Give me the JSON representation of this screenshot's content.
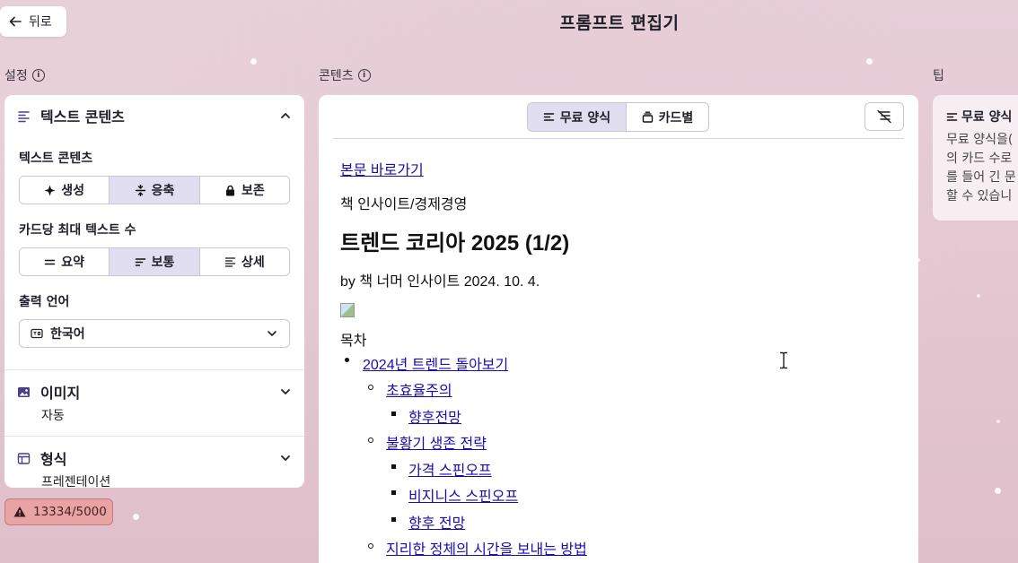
{
  "header": {
    "back_label": "뒤로",
    "title": "프롬프트 편집기"
  },
  "sections": {
    "settings": "설정",
    "content": "콘텐츠",
    "tips": "팁"
  },
  "settings": {
    "text_content": {
      "title": "텍스트 콘텐츠",
      "mode_label": "텍스트 콘텐츠",
      "modes": [
        {
          "label": "생성",
          "icon": "sparkle-icon"
        },
        {
          "label": "응축",
          "icon": "condense-icon"
        },
        {
          "label": "보존",
          "icon": "lock-icon"
        }
      ],
      "active_mode": "응축",
      "amount_label": "카드당 최대 텍스트 수",
      "amounts": [
        {
          "label": "요약",
          "icon": "short-text-icon"
        },
        {
          "label": "보통",
          "icon": "medium-text-icon"
        },
        {
          "label": "상세",
          "icon": "long-text-icon"
        }
      ],
      "active_amount": "보통",
      "language_label": "출력 언어",
      "language_value": "한국어"
    },
    "image": {
      "title": "이미지",
      "value": "자동"
    },
    "format": {
      "title": "형식",
      "value": "프레젠테이션"
    }
  },
  "credit_warning": "13334/5000",
  "content": {
    "toggle": [
      {
        "label": "무료 양식",
        "icon": "freeform-icon"
      },
      {
        "label": "카드별",
        "icon": "cards-icon"
      }
    ],
    "active_toggle": "무료 양식",
    "doc": {
      "skip_link": "본문 바로가기",
      "breadcrumb": "책 인사이트/경제경영",
      "heading": "트렌드 코리아 2025 (1/2)",
      "byline": "by 책 너머 인사이트 2024. 10. 4.",
      "toc_title": "목차",
      "toc": [
        {
          "text": "2024년 트렌드 돌아보기",
          "level": 1
        },
        {
          "text": "초효율주의",
          "level": 2
        },
        {
          "text": "향후전망",
          "level": 3
        },
        {
          "text": "불황기 생존 전략",
          "level": 2
        },
        {
          "text": "가격 스핀오프",
          "level": 3
        },
        {
          "text": "비지니스 스핀오프",
          "level": 3
        },
        {
          "text": "향후 전망",
          "level": 3
        },
        {
          "text": "지리한 정체의 시간을 보내는 방법",
          "level": 2
        }
      ]
    }
  },
  "tips": {
    "title": "무료 양식",
    "lines": [
      "무료 양식을(",
      "의 카드 수로",
      "를 들어 긴 문",
      "할 수 있습니"
    ]
  }
}
